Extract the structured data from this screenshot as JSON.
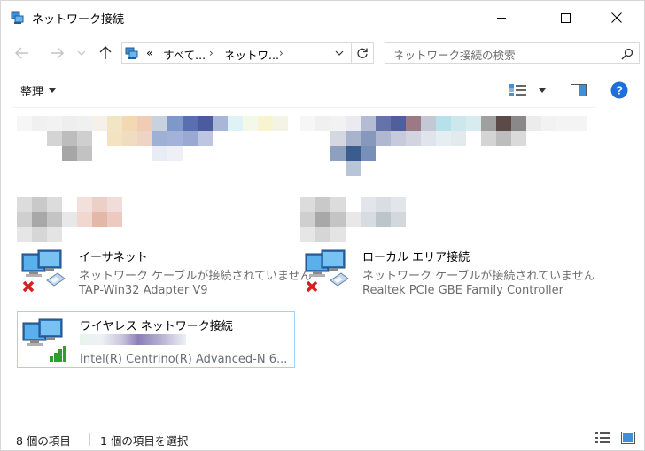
{
  "window": {
    "title": "ネットワーク接続"
  },
  "address": {
    "overflow": "«",
    "crumbs": [
      "すべて...",
      "ネットワ..."
    ]
  },
  "search": {
    "placeholder": "ネットワーク接続の検索"
  },
  "toolbar": {
    "organize_label": "整理"
  },
  "connections": [
    {
      "name": "イーサネット",
      "status": "ネットワーク ケーブルが接続されていません",
      "adapter": "TAP-Win32 Adapter V9",
      "state": "disconnected"
    },
    {
      "name": "ローカル エリア接続",
      "status": "ネットワーク ケーブルが接続されていません",
      "adapter": "Realtek PCIe GBE Family Controller",
      "state": "disconnected"
    },
    {
      "name": "ワイヤレス ネットワーク接続",
      "status": "",
      "adapter": "Intel(R) Centrino(R) Advanced-N 6...",
      "state": "connected",
      "selected": true
    }
  ],
  "statusbar": {
    "item_count": "8 個の項目",
    "selection": "1 個の項目を選択"
  },
  "colors": {
    "accent": "#0063b1",
    "selection_border": "#99d1ff",
    "secondary_text": "#6d6d6d",
    "help_blue": "#1e6fd9",
    "signal_green": "#2c9f2c",
    "disconnect_red": "#d42020"
  },
  "icons": {
    "title": "network-connections-icon",
    "back": "arrow-left-icon",
    "forward": "arrow-right-icon",
    "up": "arrow-up-icon",
    "refresh": "refresh-icon",
    "search": "magnifier-icon",
    "help": "help-icon"
  }
}
